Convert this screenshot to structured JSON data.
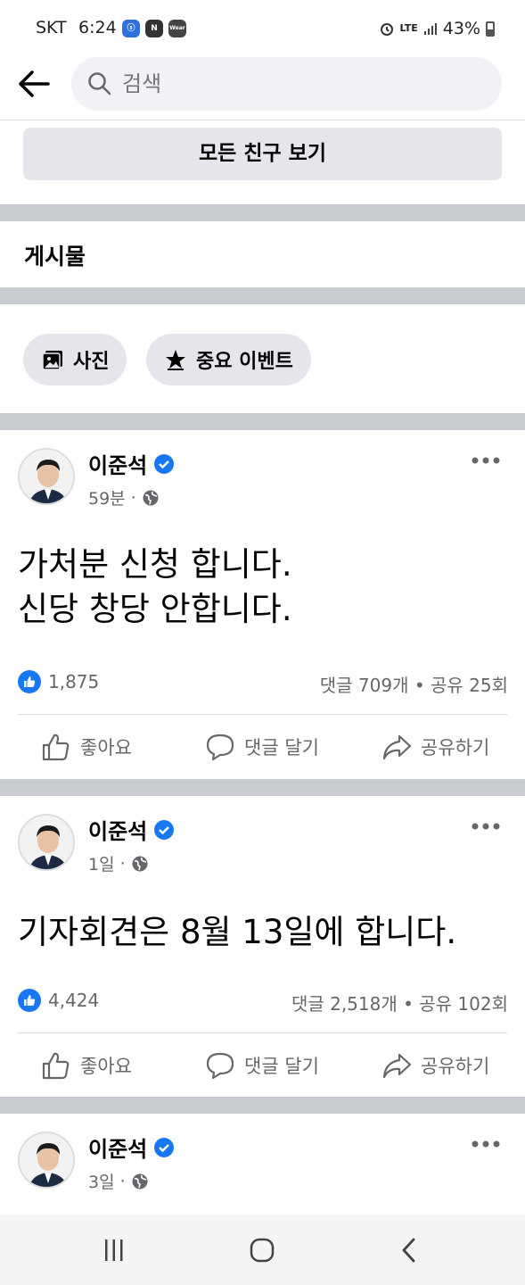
{
  "status_bar": {
    "carrier": "SKT",
    "time": "6:24",
    "app_icons": [
      "N",
      "Wear"
    ],
    "network": "LTE",
    "battery": "43%"
  },
  "header": {
    "search_placeholder": "검색"
  },
  "friends": {
    "all_friends_label": "모든 친구 보기"
  },
  "posts_section": {
    "title": "게시물",
    "chips": [
      {
        "label": "사진",
        "icon": "photo-icon"
      },
      {
        "label": "중요 이벤트",
        "icon": "star-icon"
      }
    ]
  },
  "posts": [
    {
      "author": "이준석",
      "time": "59분",
      "privacy": "public-globe-icon",
      "text": "가처분 신청 합니다.\n신당 창당 안합니다.",
      "likes": "1,875",
      "stats": "댓글 709개 • 공유 25회",
      "actions": {
        "like": "좋아요",
        "comment": "댓글 달기",
        "share": "공유하기"
      }
    },
    {
      "author": "이준석",
      "time": "1일",
      "privacy": "public-globe-icon",
      "text": "기자회견은 8월 13일에 합니다.",
      "likes": "4,424",
      "stats": "댓글 2,518개 • 공유 102회",
      "actions": {
        "like": "좋아요",
        "comment": "댓글 달기",
        "share": "공유하기"
      }
    },
    {
      "author": "이준석",
      "time": "3일",
      "privacy": "public-globe-icon"
    }
  ],
  "colors": {
    "brand_blue": "#1877f2",
    "secondary_text": "#65676b",
    "button_gray": "#e4e6eb",
    "divider_gray": "#c9ccd1"
  }
}
